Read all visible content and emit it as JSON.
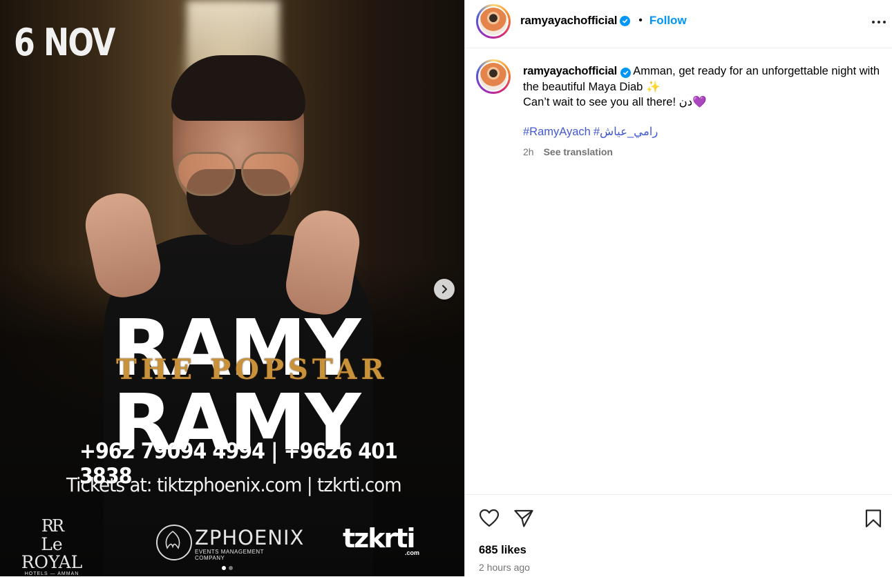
{
  "media": {
    "date": "6 NOV",
    "title_row1": "RAMY",
    "title_row2": "RAMY",
    "subtitle": "THE POPSTAR",
    "phones": "+962 79094 4994 | +9626 401 3838",
    "tickets": "Tickets at: tiktzphoenix.com | tzkrti.com",
    "logos": {
      "leroyal_mark": "RR",
      "leroyal_name": "Le ROYAL",
      "leroyal_sub": "HOTELS — AMMAN",
      "zphoenix_name": "ZPHOENIX",
      "zphoenix_sub": "EVENTS MANAGEMENT COMPANY",
      "tzkrti_name": "tzkrti",
      "tzkrti_sub": ".com"
    },
    "carousel": {
      "total": 2,
      "active": 1
    },
    "next_icon": "chevron-right-icon"
  },
  "header": {
    "username": "ramyayachofficial",
    "verified_icon": "verified-badge-icon",
    "separator": "•",
    "follow_label": "Follow",
    "more_icon": "more-horizontal-icon"
  },
  "caption": {
    "username": "ramyayachofficial",
    "line1": "Amman, get ready for an unforgettable night with the beautiful Maya Diab ✨",
    "line2": "Can’t wait to see you all there! دن💜",
    "hashtags": [
      "#RamyAyach",
      "#رامي_عياش"
    ],
    "time": "2h",
    "see_translation": "See translation"
  },
  "actions": {
    "like_icon": "heart-icon",
    "share_icon": "paper-plane-icon",
    "save_icon": "bookmark-icon",
    "likes": "685 likes",
    "time_ago": "2 hours ago"
  },
  "colors": {
    "link_blue": "#0095f6",
    "hashtag_blue": "#4359d4",
    "muted_gray": "#737373",
    "popstar_gold": "#c8913a"
  }
}
